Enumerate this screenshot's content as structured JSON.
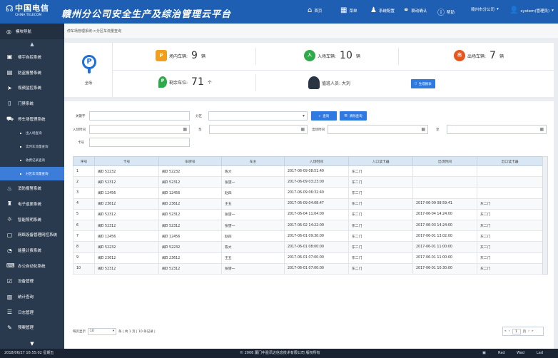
{
  "header": {
    "logo_cn": "中国电信",
    "logo_en": "CHINA TELECOM",
    "title": "赣州分公司安全生产及综治管理云平台",
    "nav": [
      {
        "icon": "home-icon",
        "label": "首页"
      },
      {
        "icon": "layout-icon",
        "label": "菜单"
      },
      {
        "icon": "bell-icon",
        "label": "系统配置"
      },
      {
        "icon": "link-icon",
        "label": "联动确认"
      },
      {
        "icon": "info-icon",
        "label": "帮助"
      }
    ],
    "org": "赣州市分公司",
    "user": "system(管理员)"
  },
  "sidebar": {
    "head": "模块导航",
    "items": [
      {
        "icon": "monitor-icon",
        "label": "楼宇自控系统"
      },
      {
        "icon": "building-icon",
        "label": "防盗报警系统"
      },
      {
        "icon": "camera-icon",
        "label": "视频监控系统"
      },
      {
        "icon": "door-icon",
        "label": "门禁系统"
      },
      {
        "icon": "car-icon",
        "label": "停车场管理系统"
      }
    ],
    "subitems": [
      {
        "label": "出入场查询",
        "active": false
      },
      {
        "label": "实时车流量查询",
        "active": false
      },
      {
        "label": "收费记录查询",
        "active": false
      },
      {
        "label": "分区车流量查询",
        "active": true
      }
    ],
    "items2": [
      {
        "icon": "fire-icon",
        "label": "消防报警系统"
      },
      {
        "icon": "person-icon",
        "label": "电子巡更系统"
      },
      {
        "icon": "bulb-icon",
        "label": "智能照明系统"
      },
      {
        "icon": "network-icon",
        "label": "网络设备管理网控系统"
      },
      {
        "icon": "meter-icon",
        "label": "能量计费系统"
      },
      {
        "icon": "office-icon",
        "label": "办公自动化系统"
      },
      {
        "icon": "device-icon",
        "label": "设备管理"
      },
      {
        "icon": "chart-icon",
        "label": "统计查询"
      },
      {
        "icon": "log-icon",
        "label": "日志管理"
      },
      {
        "icon": "plan-icon",
        "label": "预案管理"
      }
    ]
  },
  "breadcrumb": "停车场管理系统->分区车流量查询",
  "stats": {
    "area_label": "全场",
    "in_park_label": "场内车辆:",
    "in_park_value": "9",
    "in_park_unit": "辆",
    "enter_label": "入场车辆:",
    "enter_value": "10",
    "enter_unit": "辆",
    "exit_label": "出场车辆:",
    "exit_value": "7",
    "exit_unit": "辆",
    "remain_label": "剩余车位:",
    "remain_value": "71",
    "remain_unit": "个",
    "duty_label": "值班人员: 大刘",
    "report_button": "生成报表",
    "badge_enter": "入",
    "badge_exit": "出",
    "badge_p": "P"
  },
  "filters": {
    "keyword_label": "关键字",
    "zone_label": "分区",
    "search_button": "查询",
    "clear_button": "清除查询",
    "enter_time_label": "入场时间",
    "to1": "至",
    "exit_time_label": "出场时间",
    "to2": "至",
    "card_label": "卡号"
  },
  "table": {
    "headers": [
      "序号",
      "卡号",
      "车牌号",
      "车主",
      "入场时间",
      "入口读卡器",
      "出场时间",
      "出口读卡器"
    ],
    "rows": [
      [
        "1",
        "闽D 52232",
        "闽D 52232",
        "陈大",
        "2017-06-09 08:51:40",
        "东二门",
        "",
        ""
      ],
      [
        "2",
        "闽D 52312",
        "闽D 52312",
        "张望一",
        "2017-06-09 03:23:00",
        "东二门",
        "",
        ""
      ],
      [
        "3",
        "闽D 12456",
        "闽D 12456",
        "赵四",
        "2017-06-09 06:32:40",
        "东二门",
        "",
        ""
      ],
      [
        "4",
        "闽D 23612",
        "闽D 23612",
        "王五",
        "2017-06-09 04:08:47",
        "东二门",
        "2017-06-09 08:59:41",
        "东二门"
      ],
      [
        "5",
        "闽D 52312",
        "闽D 52312",
        "张望一",
        "2017-06-04 11:04:00",
        "东二门",
        "2017-06-04 14:24:00",
        "东二门"
      ],
      [
        "6",
        "闽D 52312",
        "闽D 52312",
        "张望一",
        "2017-06-02 14:22:00",
        "东二门",
        "2017-06-03 14:24:00",
        "东二门"
      ],
      [
        "7",
        "闽D 12456",
        "闽D 12456",
        "赵四",
        "2017-06-01 09:30:00",
        "东二门",
        "2017-06-01 13:02:00",
        "东二门"
      ],
      [
        "8",
        "闽D 52232",
        "闽D 52232",
        "陈大",
        "2017-06-01 08:00:00",
        "东二门",
        "2017-06-01 11:00:00",
        "东二门"
      ],
      [
        "9",
        "闽D 23612",
        "闽D 23612",
        "王五",
        "2017-06-01 07:00:00",
        "东二门",
        "2017-06-01 11:00:00",
        "东二门"
      ],
      [
        "10",
        "闽D 52312",
        "闽D 52312",
        "张望一",
        "2017-06-01 07:00:00",
        "东二门",
        "2017-06-01 10:30:00",
        "东二门"
      ]
    ]
  },
  "pager": {
    "per_page_label": "每页显示",
    "per_page": "10",
    "info": "条 | 共 1 页 | 10 条记录 |",
    "page": "1",
    "of": "页"
  },
  "statusbar": {
    "time": "2018/06/27  16:55:02  星期五",
    "copyright": "© 2006 厦门中盈讯达信息技术有限公司 版权所有",
    "items": [
      "Rad",
      "Wad",
      "Lad"
    ]
  }
}
